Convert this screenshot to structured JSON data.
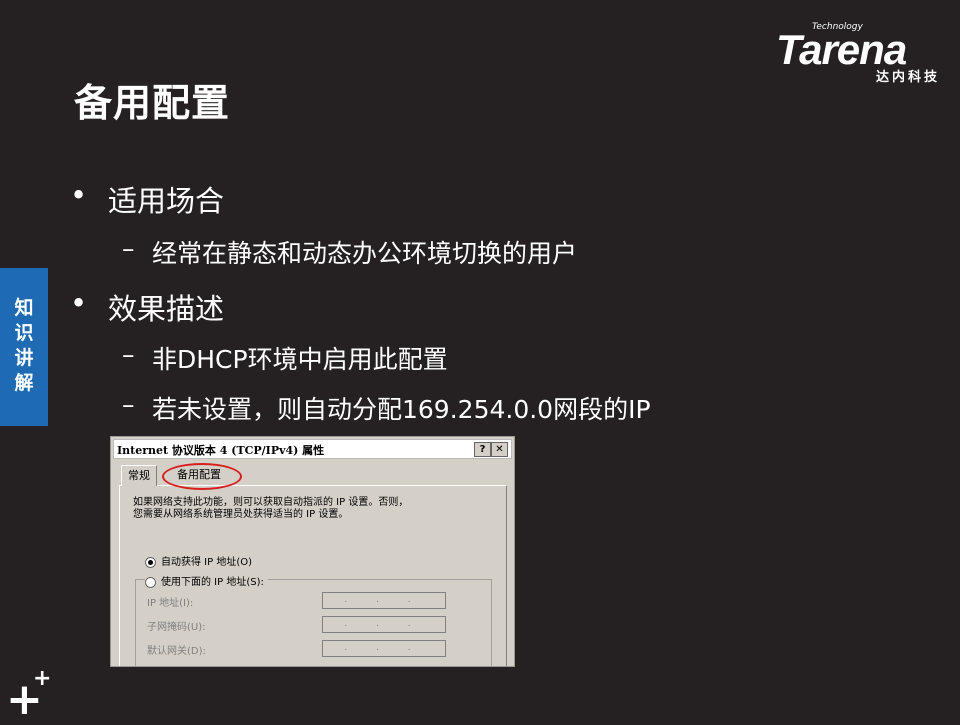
{
  "slide": {
    "title": "备用配置",
    "side_tab": "知识讲解",
    "bullets": [
      {
        "text": "适用场合",
        "subs": [
          "经常在静态和动态办公环境切换的用户"
        ]
      },
      {
        "text": "效果描述",
        "subs": [
          "非DHCP环境中启用此配置",
          "若未设置，则自动分配169.254.0.0网段的IP"
        ]
      }
    ],
    "bullet_symbol": "•",
    "dash_symbol": "–"
  },
  "logo": {
    "word": "Tarena",
    "tagline": "Technology",
    "sub": "达内科技"
  },
  "decor": {
    "plus_big": "+",
    "plus_small": "+"
  },
  "dialog": {
    "title": "Internet 协议版本 4 (TCP/IPv4) 属性",
    "help_btn": "?",
    "close_btn": "✕",
    "tabs": [
      "常规",
      "备用配置"
    ],
    "description_line1": "如果网络支持此功能，则可以获取自动指派的 IP 设置。否则，",
    "description_line2": "您需要从网络系统管理员处获得适当的 IP 设置。",
    "radio_auto": "自动获得 IP 地址(O)",
    "radio_manual": "使用下面的 IP 地址(S):",
    "fields": [
      {
        "label": "IP 地址(I):",
        "value": ". . ."
      },
      {
        "label": "子网掩码(U):",
        "value": ". . ."
      },
      {
        "label": "默认网关(D):",
        "value": ". . ."
      }
    ],
    "highlight_color": "#d62020"
  },
  "colors": {
    "background": "#252122",
    "side_tab": "#1e6ab3",
    "text": "#ffffff"
  }
}
